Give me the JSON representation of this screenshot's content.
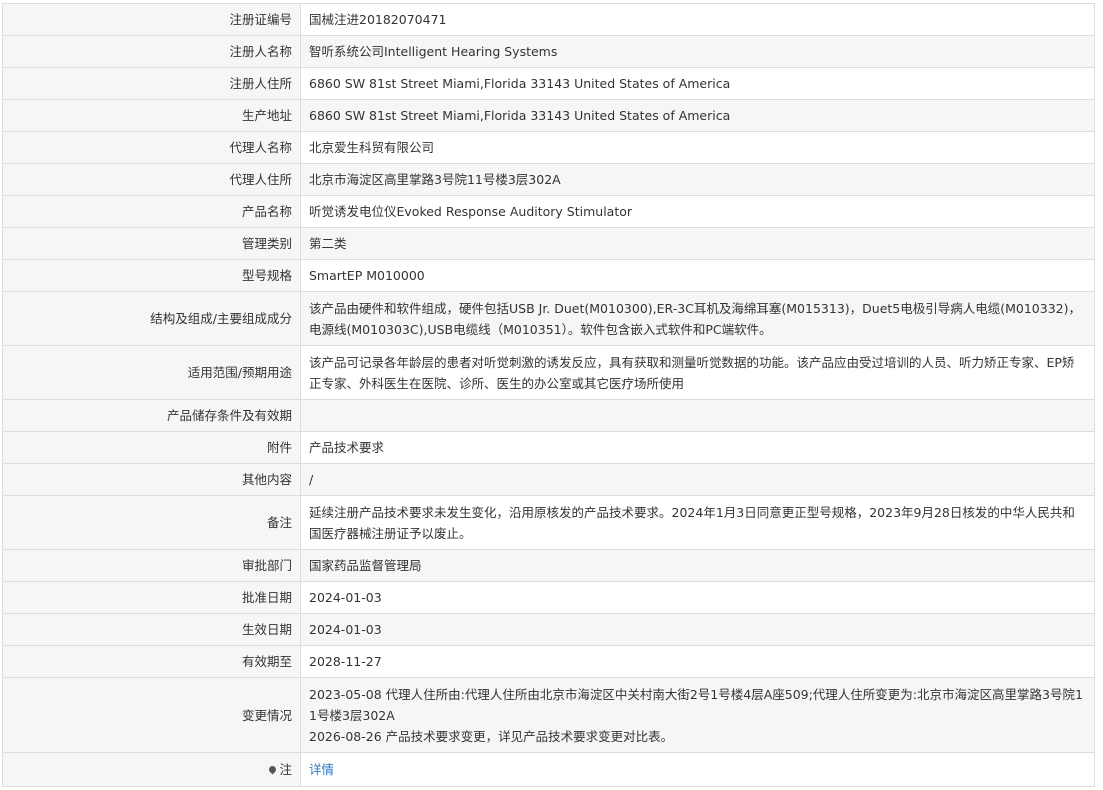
{
  "rows": [
    {
      "label": "注册证编号",
      "value": "国械注进20182070471"
    },
    {
      "label": "注册人名称",
      "value": "智听系统公司Intelligent Hearing Systems"
    },
    {
      "label": "注册人住所",
      "value": "6860 SW 81st Street Miami,Florida 33143 United States of America"
    },
    {
      "label": "生产地址",
      "value": "6860 SW 81st Street Miami,Florida 33143 United States of America"
    },
    {
      "label": "代理人名称",
      "value": "北京爱生科贸有限公司"
    },
    {
      "label": "代理人住所",
      "value": "北京市海淀区高里掌路3号院11号楼3层302A"
    },
    {
      "label": "产品名称",
      "value": "听觉诱发电位仪Evoked Response Auditory Stimulator"
    },
    {
      "label": "管理类别",
      "value": "第二类"
    },
    {
      "label": "型号规格",
      "value": "SmartEP M010000"
    },
    {
      "label": "结构及组成/主要组成成分",
      "value": "该产品由硬件和软件组成，硬件包括USB Jr. Duet(M010300),ER-3C耳机及海绵耳塞(M015313)，Duet5电极引导病人电缆(M010332)，电源线(M010303C),USB电缆线（M010351）。软件包含嵌入式软件和PC端软件。"
    },
    {
      "label": "适用范围/预期用途",
      "value": "该产品可记录各年龄层的患者对听觉刺激的诱发反应，具有获取和测量听觉数据的功能。该产品应由受过培训的人员、听力矫正专家、EP矫正专家、外科医生在医院、诊所、医生的办公室或其它医疗场所使用"
    },
    {
      "label": "产品储存条件及有效期",
      "value": ""
    },
    {
      "label": "附件",
      "value": "产品技术要求"
    },
    {
      "label": "其他内容",
      "value": "/"
    },
    {
      "label": "备注",
      "value": "延续注册产品技术要求未发生变化，沿用原核发的产品技术要求。2024年1月3日同意更正型号规格，2023年9月28日核发的中华人民共和国医疗器械注册证予以废止。"
    },
    {
      "label": "审批部门",
      "value": "国家药品监督管理局"
    },
    {
      "label": "批准日期",
      "value": "2024-01-03"
    },
    {
      "label": "生效日期",
      "value": "2024-01-03"
    },
    {
      "label": "有效期至",
      "value": "2028-11-27"
    }
  ],
  "change_row": {
    "label": "变更情况",
    "lines": [
      "2023-05-08 代理人住所由:代理人住所由北京市海淀区中关村南大街2号1号楼4层A座509;代理人住所变更为:北京市海淀区高里掌路3号院11号楼3层302A",
      "2026-08-26 产品技术要求变更，详见产品技术要求变更对比表。"
    ]
  },
  "note_row": {
    "icon": "location-pin-icon",
    "label": "注",
    "link_text": "详情"
  }
}
